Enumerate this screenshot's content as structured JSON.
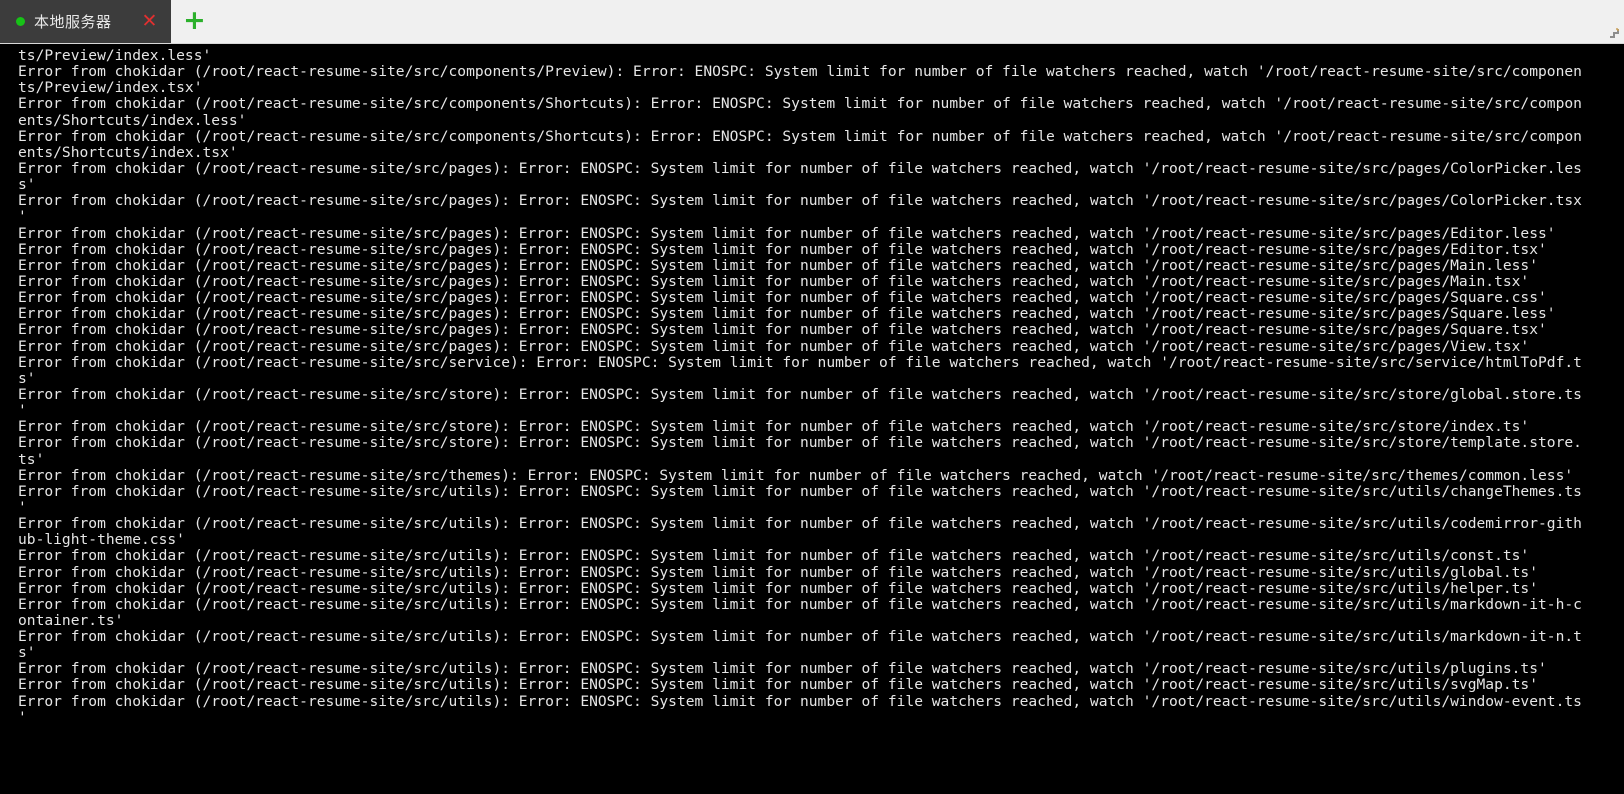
{
  "window": {
    "background_color": "#000000",
    "tabbar_background": "#f0f0f0"
  },
  "tabbar": {
    "tabs": [
      {
        "title": "本地服务器",
        "status_dot_color": "#17c217",
        "status_dot_icon": "green-circle-icon",
        "close_label": "✕",
        "close_icon": "close-icon",
        "active": true
      }
    ],
    "new_tab_label": "+",
    "new_tab_icon": "plus-icon",
    "resize_grip_icon": "resize-grip-icon"
  },
  "terminal": {
    "foreground_color": "#e6e6e6",
    "background_color": "#000000",
    "lines": [
      "ts/Preview/index.less'",
      "Error from chokidar (/root/react-resume-site/src/components/Preview): Error: ENOSPC: System limit for number of file watchers reached, watch '/root/react-resume-site/src/componen",
      "ts/Preview/index.tsx'",
      "Error from chokidar (/root/react-resume-site/src/components/Shortcuts): Error: ENOSPC: System limit for number of file watchers reached, watch '/root/react-resume-site/src/compon",
      "ents/Shortcuts/index.less'",
      "Error from chokidar (/root/react-resume-site/src/components/Shortcuts): Error: ENOSPC: System limit for number of file watchers reached, watch '/root/react-resume-site/src/compon",
      "ents/Shortcuts/index.tsx'",
      "Error from chokidar (/root/react-resume-site/src/pages): Error: ENOSPC: System limit for number of file watchers reached, watch '/root/react-resume-site/src/pages/ColorPicker.les",
      "s'",
      "Error from chokidar (/root/react-resume-site/src/pages): Error: ENOSPC: System limit for number of file watchers reached, watch '/root/react-resume-site/src/pages/ColorPicker.tsx",
      "'",
      "Error from chokidar (/root/react-resume-site/src/pages): Error: ENOSPC: System limit for number of file watchers reached, watch '/root/react-resume-site/src/pages/Editor.less'",
      "Error from chokidar (/root/react-resume-site/src/pages): Error: ENOSPC: System limit for number of file watchers reached, watch '/root/react-resume-site/src/pages/Editor.tsx'",
      "Error from chokidar (/root/react-resume-site/src/pages): Error: ENOSPC: System limit for number of file watchers reached, watch '/root/react-resume-site/src/pages/Main.less'",
      "Error from chokidar (/root/react-resume-site/src/pages): Error: ENOSPC: System limit for number of file watchers reached, watch '/root/react-resume-site/src/pages/Main.tsx'",
      "Error from chokidar (/root/react-resume-site/src/pages): Error: ENOSPC: System limit for number of file watchers reached, watch '/root/react-resume-site/src/pages/Square.css'",
      "Error from chokidar (/root/react-resume-site/src/pages): Error: ENOSPC: System limit for number of file watchers reached, watch '/root/react-resume-site/src/pages/Square.less'",
      "Error from chokidar (/root/react-resume-site/src/pages): Error: ENOSPC: System limit for number of file watchers reached, watch '/root/react-resume-site/src/pages/Square.tsx'",
      "Error from chokidar (/root/react-resume-site/src/pages): Error: ENOSPC: System limit for number of file watchers reached, watch '/root/react-resume-site/src/pages/View.tsx'",
      "Error from chokidar (/root/react-resume-site/src/service): Error: ENOSPC: System limit for number of file watchers reached, watch '/root/react-resume-site/src/service/htmlToPdf.t",
      "s'",
      "Error from chokidar (/root/react-resume-site/src/store): Error: ENOSPC: System limit for number of file watchers reached, watch '/root/react-resume-site/src/store/global.store.ts",
      "'",
      "Error from chokidar (/root/react-resume-site/src/store): Error: ENOSPC: System limit for number of file watchers reached, watch '/root/react-resume-site/src/store/index.ts'",
      "Error from chokidar (/root/react-resume-site/src/store): Error: ENOSPC: System limit for number of file watchers reached, watch '/root/react-resume-site/src/store/template.store.",
      "ts'",
      "Error from chokidar (/root/react-resume-site/src/themes): Error: ENOSPC: System limit for number of file watchers reached, watch '/root/react-resume-site/src/themes/common.less'",
      "Error from chokidar (/root/react-resume-site/src/utils): Error: ENOSPC: System limit for number of file watchers reached, watch '/root/react-resume-site/src/utils/changeThemes.ts",
      "'",
      "Error from chokidar (/root/react-resume-site/src/utils): Error: ENOSPC: System limit for number of file watchers reached, watch '/root/react-resume-site/src/utils/codemirror-gith",
      "ub-light-theme.css'",
      "Error from chokidar (/root/react-resume-site/src/utils): Error: ENOSPC: System limit for number of file watchers reached, watch '/root/react-resume-site/src/utils/const.ts'",
      "Error from chokidar (/root/react-resume-site/src/utils): Error: ENOSPC: System limit for number of file watchers reached, watch '/root/react-resume-site/src/utils/global.ts'",
      "Error from chokidar (/root/react-resume-site/src/utils): Error: ENOSPC: System limit for number of file watchers reached, watch '/root/react-resume-site/src/utils/helper.ts'",
      "Error from chokidar (/root/react-resume-site/src/utils): Error: ENOSPC: System limit for number of file watchers reached, watch '/root/react-resume-site/src/utils/markdown-it-h-c",
      "ontainer.ts'",
      "Error from chokidar (/root/react-resume-site/src/utils): Error: ENOSPC: System limit for number of file watchers reached, watch '/root/react-resume-site/src/utils/markdown-it-n.t",
      "s'",
      "Error from chokidar (/root/react-resume-site/src/utils): Error: ENOSPC: System limit for number of file watchers reached, watch '/root/react-resume-site/src/utils/plugins.ts'",
      "Error from chokidar (/root/react-resume-site/src/utils): Error: ENOSPC: System limit for number of file watchers reached, watch '/root/react-resume-site/src/utils/svgMap.ts'",
      "Error from chokidar (/root/react-resume-site/src/utils): Error: ENOSPC: System limit for number of file watchers reached, watch '/root/react-resume-site/src/utils/window-event.ts",
      "'"
    ]
  }
}
